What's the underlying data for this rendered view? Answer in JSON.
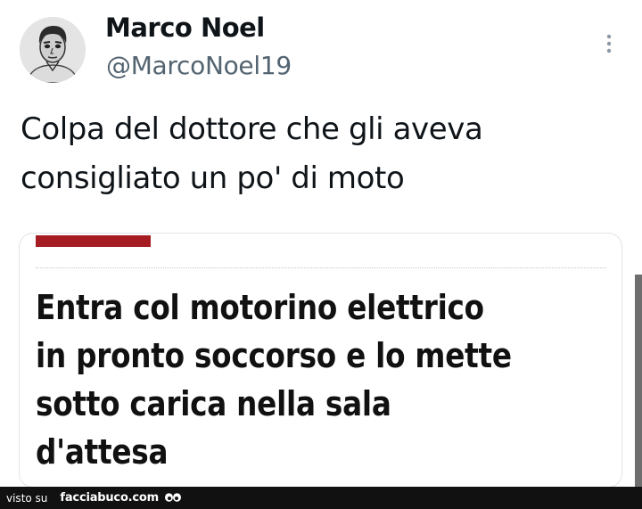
{
  "tweet": {
    "author": {
      "name": "Marco Noel",
      "handle": "@MarcoNoel19",
      "avatar": "profile-photo"
    },
    "menu_icon": "more-vertical-icon",
    "text": "Colpa del dottore che gli aveva consigliato un po' di moto",
    "text_lines": [
      "Colpa del dottore che gli aveva",
      "consigliato un po' di moto"
    ]
  },
  "card": {
    "accent_color": "#a51c22",
    "headline_lines": [
      "Entra col motorino elettrico",
      "in pronto soccorso e lo mette",
      "sotto carica nella sala",
      "d'attesa"
    ]
  },
  "footer": {
    "prefix": "visto su",
    "site": "facciabuco.com",
    "logo": "googly-eyes-icon"
  },
  "colors": {
    "text": "#0f1419",
    "secondary": "#536471",
    "card_border": "#dfe3e7",
    "footer_bg": "#111111"
  }
}
